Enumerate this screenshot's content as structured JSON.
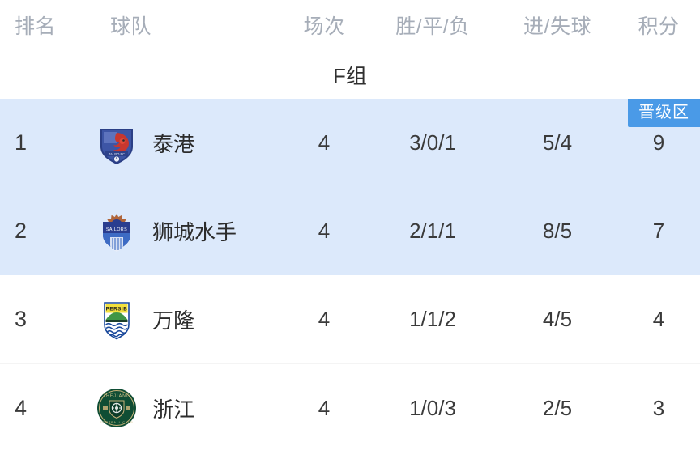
{
  "table": {
    "columns": {
      "rank": "排名",
      "team": "球队",
      "played": "场次",
      "wdl": "胜/平/负",
      "goals": "进/失球",
      "points": "积分"
    },
    "group_title": "F组",
    "zone_badge": "晋级区",
    "colors": {
      "zone_background": "#dce9fb",
      "zone_badge": "#4a9ae7",
      "header_text": "#a6adb8",
      "body_text": "#3a3a3a",
      "page_background": "#ffffff"
    },
    "rows": [
      {
        "rank": "1",
        "team": "泰港",
        "crest": "tai-po-crest-icon",
        "played": "4",
        "wdl": "3/0/1",
        "goals": "5/4",
        "points": "9",
        "qualified": true
      },
      {
        "rank": "2",
        "team": "狮城水手",
        "crest": "lion-city-sailors-crest-icon",
        "played": "4",
        "wdl": "2/1/1",
        "goals": "8/5",
        "points": "7",
        "qualified": true
      },
      {
        "rank": "3",
        "team": "万隆",
        "crest": "persib-bandung-crest-icon",
        "played": "4",
        "wdl": "1/1/2",
        "goals": "4/5",
        "points": "4",
        "qualified": false
      },
      {
        "rank": "4",
        "team": "浙江",
        "crest": "zhejiang-crest-icon",
        "played": "4",
        "wdl": "1/0/3",
        "goals": "2/5",
        "points": "3",
        "qualified": false
      }
    ]
  }
}
